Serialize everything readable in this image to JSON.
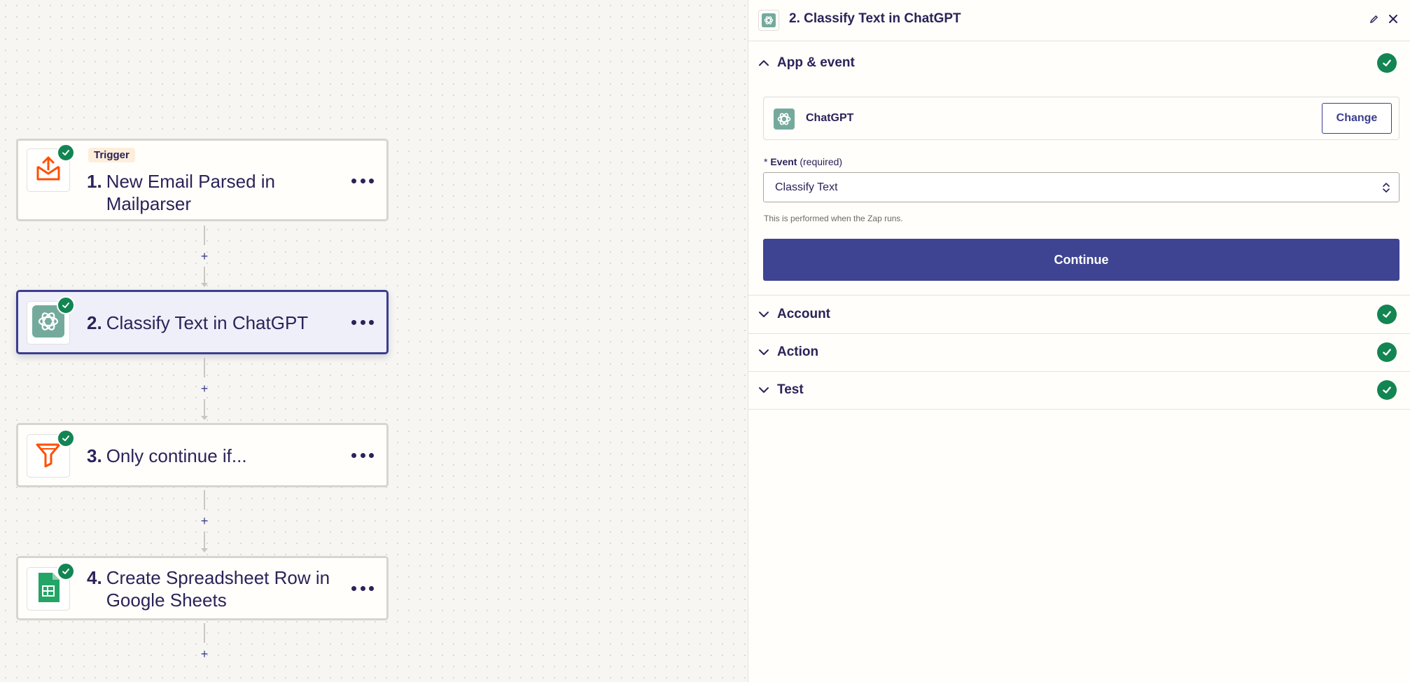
{
  "canvas": {
    "steps": [
      {
        "tag": "Trigger",
        "number": "1.",
        "title": "New Email Parsed in Mailparser",
        "icon": "mailparser-icon"
      },
      {
        "number": "2.",
        "title": "Classify Text in ChatGPT",
        "icon": "chatgpt-icon"
      },
      {
        "number": "3.",
        "title": "Only continue if...",
        "icon": "filter-icon"
      },
      {
        "number": "4.",
        "title": "Create Spreadsheet Row in Google Sheets",
        "icon": "google-sheets-icon"
      }
    ],
    "add_step_label": "+"
  },
  "panel": {
    "title": "2. Classify Text in ChatGPT",
    "sections": {
      "app_event": "App & event",
      "account": "Account",
      "action": "Action",
      "test": "Test"
    },
    "app_name": "ChatGPT",
    "change_label": "Change",
    "event": {
      "required_mark": "*",
      "label": "Event",
      "required_text": "(required)",
      "value": "Classify Text",
      "helper": "This is performed when the Zap runs."
    },
    "continue_label": "Continue"
  },
  "colors": {
    "primary": "#3e4491",
    "success": "#128552",
    "accent_orange": "#ff4f00",
    "chatgpt_green": "#74aa9c",
    "sheets_green": "#23a566"
  }
}
